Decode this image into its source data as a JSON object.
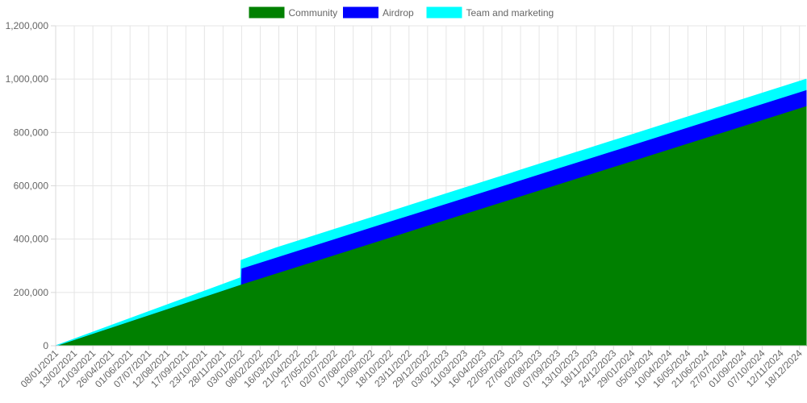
{
  "chart_data": {
    "type": "area",
    "stacked": true,
    "legend_position": "top",
    "grid": true,
    "ylim": [
      0,
      1200000
    ],
    "y_ticks": [
      "0",
      "200,000",
      "400,000",
      "600,000",
      "800,000",
      "1,000,000",
      "1,200,000"
    ],
    "x_tick_labels": [
      "08/01/2021",
      "13/02/2021",
      "21/03/2021",
      "26/04/2021",
      "01/06/2021",
      "07/07/2021",
      "12/08/2021",
      "17/09/2021",
      "23/10/2021",
      "28/11/2021",
      "03/01/2022",
      "08/02/2022",
      "16/03/2022",
      "21/04/2022",
      "27/05/2022",
      "02/07/2022",
      "07/08/2022",
      "12/09/2022",
      "18/10/2022",
      "23/11/2022",
      "29/12/2022",
      "03/02/2023",
      "11/03/2023",
      "16/04/2023",
      "22/05/2023",
      "27/06/2023",
      "02/08/2023",
      "07/09/2023",
      "13/10/2023",
      "18/11/2023",
      "24/12/2023",
      "29/01/2024",
      "05/03/2024",
      "10/04/2024",
      "16/05/2024",
      "21/06/2024",
      "27/07/2024",
      "01/09/2024",
      "07/10/2024",
      "12/11/2024",
      "18/12/2024"
    ],
    "x_range": [
      "08/01/2021",
      "31/12/2024"
    ],
    "series": [
      {
        "name": "Community",
        "color": "#008000",
        "points": [
          [
            "08/01/2021",
            0
          ],
          [
            "01/01/2022",
            230000
          ],
          [
            "31/12/2024",
            900000
          ]
        ]
      },
      {
        "name": "Airdrop",
        "color": "#0000ff",
        "points": [
          [
            "08/01/2021",
            0
          ],
          [
            "01/01/2022",
            0
          ],
          [
            "02/01/2022",
            60000
          ],
          [
            "31/12/2024",
            60000
          ]
        ]
      },
      {
        "name": "Team and marketing",
        "color": "#00ffff",
        "points": [
          [
            "08/01/2021",
            0
          ],
          [
            "01/01/2022",
            25000
          ],
          [
            "02/01/2022",
            30000
          ],
          [
            "11/03/2022",
            35000
          ],
          [
            "31/12/2024",
            40000
          ]
        ]
      }
    ]
  }
}
